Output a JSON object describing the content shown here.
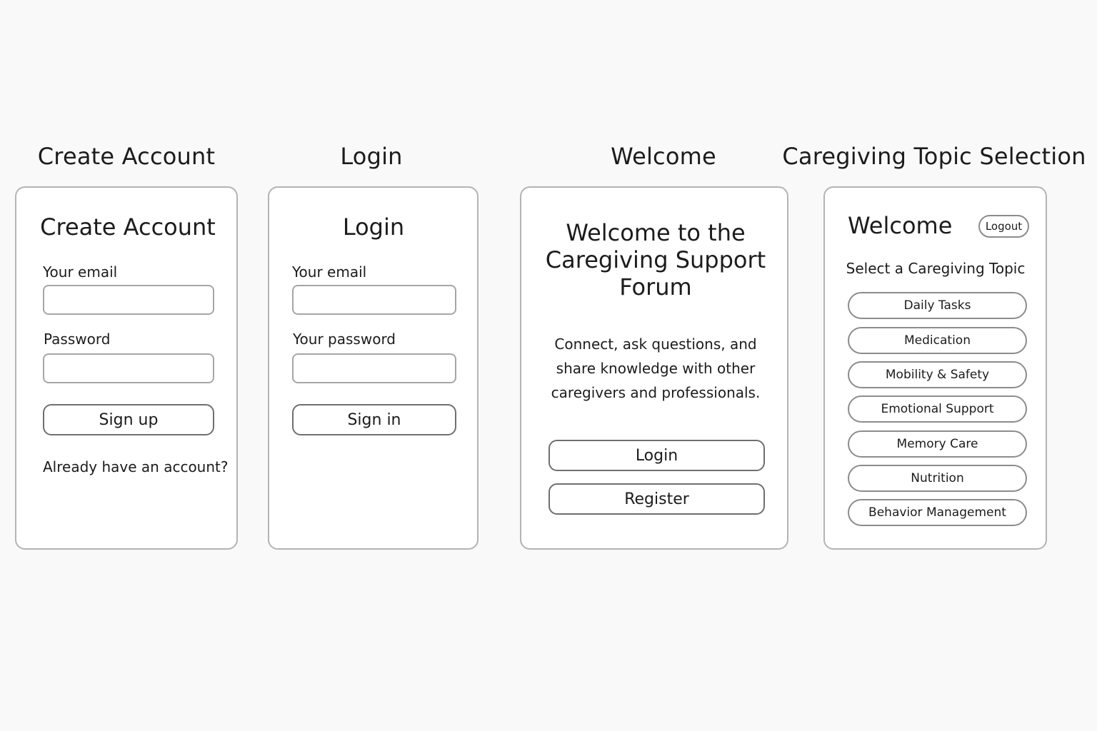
{
  "columns": {
    "create_account": "Create Account",
    "login": "Login",
    "welcome": "Welcome",
    "topic_selection": "Caregiving Topic Selection"
  },
  "create_account": {
    "title": "Create Account",
    "email_label": "Your email",
    "password_label": "Password",
    "signup_button": "Sign up",
    "footer_text": "Already have an account?"
  },
  "login": {
    "title": "Login",
    "email_label": "Your email",
    "password_label": "Your password",
    "signin_button": "Sign in"
  },
  "welcome": {
    "heading": "Welcome to the\nCaregiving Support\nForum",
    "body": "Connect, ask questions, and\nshare knowledge with other\ncaregivers and professionals.",
    "login_button": "Login",
    "register_button": "Register"
  },
  "topics": {
    "title": "Welcome",
    "logout_button": "Logout",
    "subtitle": "Select a Caregiving Topic",
    "items": [
      "Daily Tasks",
      "Medication",
      "Mobility & Safety",
      "Emotional Support",
      "Memory Care",
      "Nutrition",
      "Behavior Management"
    ]
  }
}
